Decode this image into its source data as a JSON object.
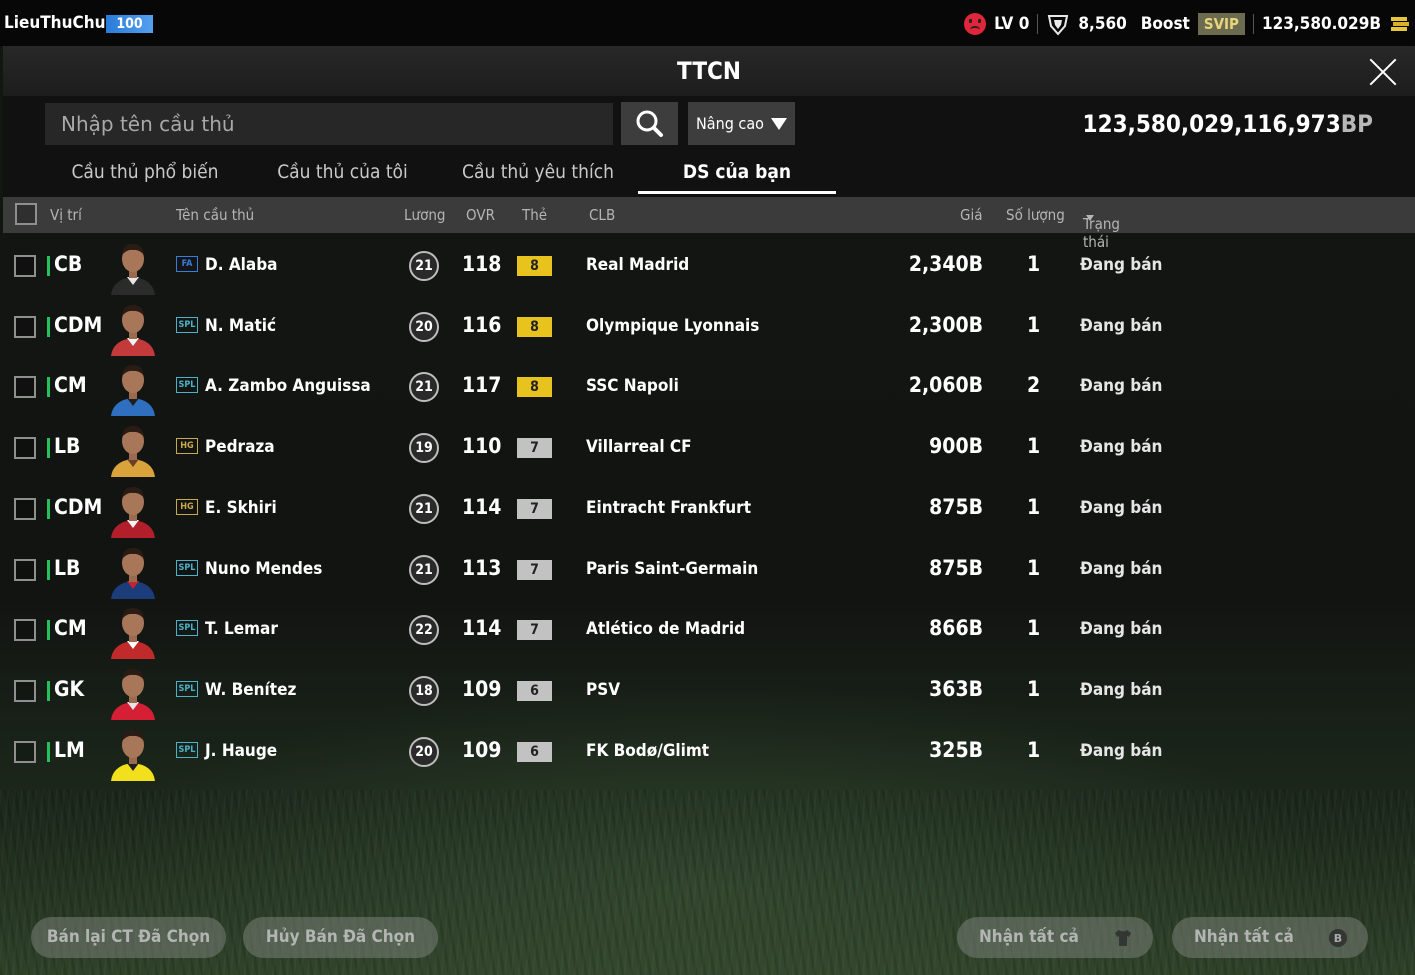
{
  "topbar": {
    "username": "LieuThuChuc",
    "level_badge": "100",
    "lv": "LV 0",
    "trophy_count": "8,560",
    "boost_label": "Boost",
    "svip_label": "SVIP",
    "coins": "123,580.029B"
  },
  "dialog": {
    "title": "TTCN"
  },
  "search": {
    "placeholder": "Nhập tên cầu thủ",
    "advanced_label": "Nâng cao"
  },
  "balance": {
    "amount": "123,580,029,116,973",
    "unit": "BP"
  },
  "tabs": [
    {
      "label": "Cầu thủ phổ biến"
    },
    {
      "label": "Cầu thủ của tôi"
    },
    {
      "label": "Cầu thủ yêu thích"
    },
    {
      "label": "DS của bạn"
    }
  ],
  "table": {
    "headers": {
      "position": "Vị trí",
      "name": "Tên cầu thủ",
      "salary": "Lương",
      "ovr": "OVR",
      "grade": "Thẻ",
      "club": "CLB",
      "price": "Giá",
      "qty": "Số lượng",
      "status": "Trạng thái"
    },
    "rows": [
      {
        "pos": "CB",
        "season": "FA",
        "name": "D. Alaba",
        "salary": "21",
        "ovr": "118",
        "grade": "8",
        "club": "Real Madrid",
        "price": "2,340B",
        "qty": "1",
        "status": "Đang bán"
      },
      {
        "pos": "CDM",
        "season": "SPL",
        "name": "N. Matić",
        "salary": "20",
        "ovr": "116",
        "grade": "8",
        "club": "Olympique Lyonnais",
        "price": "2,300B",
        "qty": "1",
        "status": "Đang bán"
      },
      {
        "pos": "CM",
        "season": "SPL",
        "name": "A. Zambo Anguissa",
        "salary": "21",
        "ovr": "117",
        "grade": "8",
        "club": "SSC Napoli",
        "price": "2,060B",
        "qty": "2",
        "status": "Đang bán"
      },
      {
        "pos": "LB",
        "season": "HG",
        "name": "Pedraza",
        "salary": "19",
        "ovr": "110",
        "grade": "7",
        "club": "Villarreal CF",
        "price": "900B",
        "qty": "1",
        "status": "Đang bán"
      },
      {
        "pos": "CDM",
        "season": "HG",
        "name": "E. Skhiri",
        "salary": "21",
        "ovr": "114",
        "grade": "7",
        "club": "Eintracht Frankfurt",
        "price": "875B",
        "qty": "1",
        "status": "Đang bán"
      },
      {
        "pos": "LB",
        "season": "SPL",
        "name": "Nuno Mendes",
        "salary": "21",
        "ovr": "113",
        "grade": "7",
        "club": "Paris Saint-Germain",
        "price": "875B",
        "qty": "1",
        "status": "Đang bán"
      },
      {
        "pos": "CM",
        "season": "SPL",
        "name": "T. Lemar",
        "salary": "22",
        "ovr": "114",
        "grade": "7",
        "club": "Atlético de Madrid",
        "price": "866B",
        "qty": "1",
        "status": "Đang bán"
      },
      {
        "pos": "GK",
        "season": "SPL",
        "name": "W. Benítez",
        "salary": "18",
        "ovr": "109",
        "grade": "6",
        "club": "PSV",
        "price": "363B",
        "qty": "1",
        "status": "Đang bán"
      },
      {
        "pos": "LM",
        "season": "SPL",
        "name": "J. Hauge",
        "salary": "20",
        "ovr": "109",
        "grade": "6",
        "club": "FK Bodø/Glimt",
        "price": "325B",
        "qty": "1",
        "status": "Đang bán"
      }
    ]
  },
  "buttons": {
    "resell_selected": "Bán lại CT Đã Chọn",
    "cancel_selected": "Hủy Bán Đã Chọn",
    "receive_all_1": "Nhận tất cả",
    "receive_all_2": "Nhận tất cả"
  },
  "colors": {
    "position_bar": "#23c25a",
    "grade_gold": "#e8c21d",
    "grade_silver": "#c2c2c2",
    "level_badge": "#2b7bd9",
    "season_fa": "#3a7be0",
    "season_spl": "#4bb3c9",
    "season_hg": "#c9a94b"
  }
}
